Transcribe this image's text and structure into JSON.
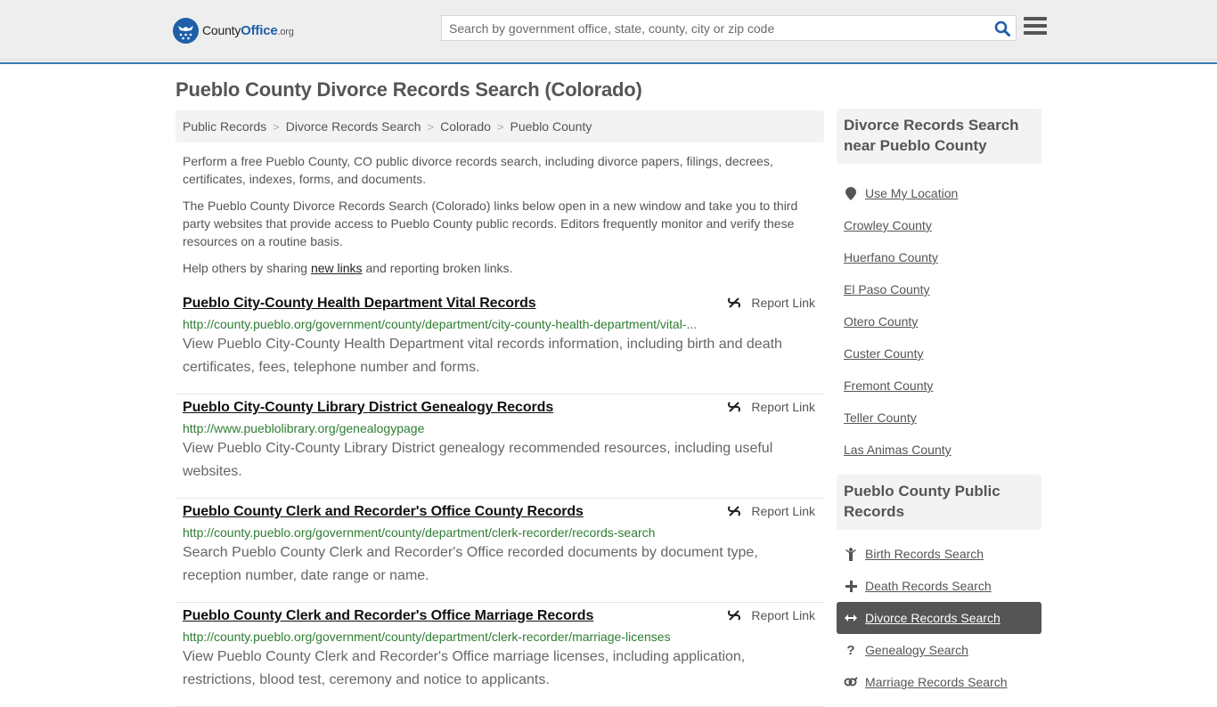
{
  "header": {
    "logo": {
      "county": "County",
      "office": "Office",
      "tld": ".org"
    },
    "search_placeholder": "Search by government office, state, county, city or zip code",
    "search_icon": "search-icon",
    "menu_icon": "hamburger-menu-icon"
  },
  "page": {
    "title": "Pueblo County Divorce Records Search (Colorado)"
  },
  "breadcrumb": [
    {
      "label": "Public Records"
    },
    {
      "label": "Divorce Records Search"
    },
    {
      "label": "Colorado"
    },
    {
      "label": "Pueblo County"
    }
  ],
  "intro": {
    "p1": "Perform a free Pueblo County, CO public divorce records search, including divorce papers, filings, decrees, certificates, indexes, forms, and documents.",
    "p2": "The Pueblo County Divorce Records Search (Colorado) links below open in a new window and take you to third party websites that provide access to Pueblo County public records. Editors frequently monitor and verify these resources on a routine basis.",
    "p3_before": "Help others by sharing ",
    "p3_link": "new links",
    "p3_after": " and reporting broken links."
  },
  "report_label": "Report Link",
  "results": [
    {
      "title": "Pueblo City-County Health Department Vital Records",
      "url": "http://county.pueblo.org/government/county/department/city-county-health-department/vital-...",
      "description": "View Pueblo City-County Health Department vital records information, including birth and death certificates, fees, telephone number and forms."
    },
    {
      "title": "Pueblo City-County Library District Genealogy Records",
      "url": "http://www.pueblolibrary.org/genealogypage",
      "description": "View Pueblo City-County Library District genealogy recommended resources, including useful websites."
    },
    {
      "title": "Pueblo County Clerk and Recorder's Office County Records",
      "url": "http://county.pueblo.org/government/county/department/clerk-recorder/records-search",
      "description": "Search Pueblo County Clerk and Recorder's Office recorded documents by document type, reception number, date range or name."
    },
    {
      "title": "Pueblo County Clerk and Recorder's Office Marriage Records",
      "url": "http://county.pueblo.org/government/county/department/clerk-recorder/marriage-licenses",
      "description": "View Pueblo County Clerk and Recorder's Office marriage licenses, including application, restrictions, blood test, ceremony and notice to applicants."
    }
  ],
  "sidebar": {
    "nearby": {
      "heading": "Divorce Records Search near Pueblo County",
      "use_location": "Use My Location",
      "counties": [
        "Crowley County",
        "Huerfano County",
        "El Paso County",
        "Otero County",
        "Custer County",
        "Fremont County",
        "Teller County",
        "Las Animas County"
      ]
    },
    "public_records": {
      "heading": "Pueblo County Public Records",
      "items": [
        {
          "label": "Birth Records Search",
          "icon": "child-icon",
          "active": false
        },
        {
          "label": "Death Records Search",
          "icon": "plus-cross-icon",
          "active": false
        },
        {
          "label": "Divorce Records Search",
          "icon": "arrows-horizontal-icon",
          "active": true
        },
        {
          "label": "Genealogy Search",
          "icon": "question-icon",
          "active": false
        },
        {
          "label": "Marriage Records Search",
          "icon": "mars-venus-icon",
          "active": false
        }
      ]
    }
  },
  "colors": {
    "brand_blue": "#1e5fa8",
    "header_bg": "#eeeeee",
    "header_border": "#3a7bb0",
    "url_green": "#2e7d32",
    "active_item_bg": "#555555"
  }
}
